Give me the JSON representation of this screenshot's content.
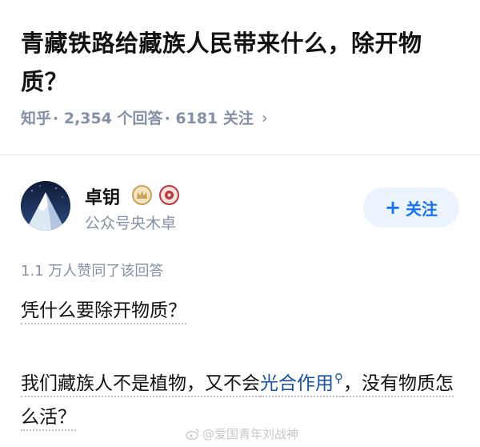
{
  "question": {
    "title": "青藏铁路给藏族人民带来什么，除开物质？",
    "source": "知乎",
    "answers": "· 2,354 个回答",
    "followers": "· 6181 关注",
    "chevron_icon": "chevron-right-icon"
  },
  "author": {
    "name": "卓钥",
    "bio": "公众号央木卓",
    "avatar_icon": "snow-mountain-avatar",
    "badges": [
      "crown-badge-icon",
      "red-badge-icon"
    ],
    "follow_label": "关注"
  },
  "answer": {
    "upvote_text": "1.1 万人赞同了该回答",
    "para1": "凭什么要除开物质？",
    "para2_before": "我们藏族人不是植物，又不会",
    "para2_link": "光合作用",
    "para2_after": "，没有物质怎么活？"
  },
  "watermark": {
    "text": "@爱国青年刘战神"
  },
  "colors": {
    "accent": "#1772f6",
    "link": "#175199",
    "meta_gray": "#8590a6",
    "follow_bg": "#ebf4fd"
  }
}
